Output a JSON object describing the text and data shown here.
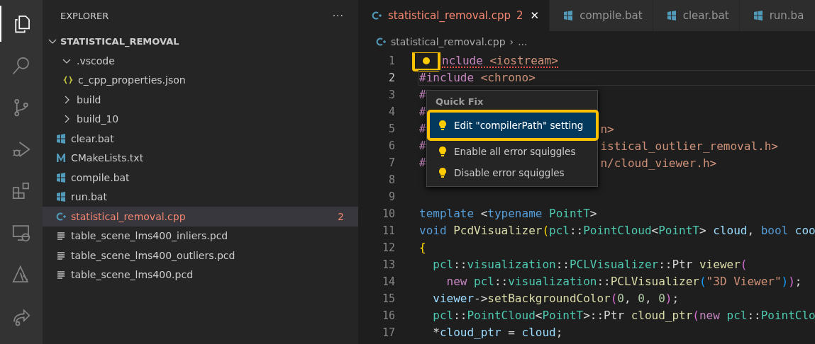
{
  "activity_bar": [
    {
      "selected": true
    },
    {
      "selected": false
    },
    {
      "selected": false
    },
    {
      "selected": false
    },
    {
      "selected": false
    },
    {
      "selected": false
    },
    {
      "selected": false
    },
    {
      "selected": false
    }
  ],
  "sidebar": {
    "title": "EXPLORER",
    "more": "···",
    "root": {
      "label": "STATISTICAL_REMOVAL",
      "expanded": true,
      "children": [
        {
          "label": ".vscode",
          "kind": "folder",
          "expanded": true,
          "selected": false,
          "children": [
            {
              "label": "c_cpp_properties.json",
              "kind": "json",
              "selected": false
            }
          ]
        },
        {
          "label": "build",
          "kind": "folder",
          "expanded": false,
          "selected": false
        },
        {
          "label": "build_10",
          "kind": "folder",
          "expanded": false,
          "selected": false
        },
        {
          "label": "clear.bat",
          "kind": "bat",
          "selected": false
        },
        {
          "label": "CMakeLists.txt",
          "kind": "cmake",
          "selected": false
        },
        {
          "label": "compile.bat",
          "kind": "bat",
          "selected": false
        },
        {
          "label": "run.bat",
          "kind": "bat",
          "selected": false
        },
        {
          "label": "statistical_removal.cpp",
          "kind": "cpp",
          "selected": true,
          "errors": "2"
        },
        {
          "label": "table_scene_lms400_inliers.pcd",
          "kind": "text",
          "selected": false
        },
        {
          "label": "table_scene_lms400_outliers.pcd",
          "kind": "text",
          "selected": false
        },
        {
          "label": "table_scene_lms400.pcd",
          "kind": "text",
          "selected": false
        }
      ]
    }
  },
  "tabs": [
    {
      "label": "statistical_removal.cpp",
      "kind": "cpp",
      "selected": true,
      "errors": "2",
      "close": "✕"
    },
    {
      "label": "compile.bat",
      "kind": "bat",
      "selected": false
    },
    {
      "label": "clear.bat",
      "kind": "bat",
      "selected": false
    },
    {
      "label": "run.ba",
      "kind": "bat",
      "selected": false
    }
  ],
  "breadcrumb": {
    "file": "statistical_removal.cpp",
    "separator": "›",
    "rest": "..."
  },
  "code": [
    {
      "n": "1",
      "current": false,
      "error": true,
      "bulb": true,
      "tokens": [
        {
          "t": "nclude",
          "kind": "pp"
        },
        {
          "t": " <iostream>",
          "kind": "str"
        }
      ]
    },
    {
      "n": "2",
      "current": true,
      "error": false,
      "bulb": false,
      "tokens": [
        {
          "t": "#include",
          "kind": "pp"
        },
        {
          "t": " <chrono>",
          "kind": "str"
        }
      ]
    },
    {
      "n": "3",
      "current": false,
      "error": false,
      "bulb": false,
      "tokens": [
        {
          "t": "#",
          "kind": "pp"
        }
      ]
    },
    {
      "n": "4",
      "current": false,
      "error": false,
      "bulb": false,
      "tokens": [
        {
          "t": "#",
          "kind": "pp"
        }
      ]
    },
    {
      "n": "5",
      "current": false,
      "error": false,
      "bulb": false,
      "tokens": [
        {
          "t": "#",
          "kind": "pp"
        }
      ],
      "tail": {
        "t": "n>",
        "kind": "str"
      }
    },
    {
      "n": "6",
      "current": false,
      "error": false,
      "bulb": false,
      "tokens": [
        {
          "t": "#",
          "kind": "pp"
        }
      ],
      "tail": {
        "t": "istical_outlier_removal.h>",
        "kind": "str"
      }
    },
    {
      "n": "7",
      "current": false,
      "error": false,
      "bulb": false,
      "tokens": [
        {
          "t": "#",
          "kind": "pp"
        }
      ],
      "tail": {
        "t": "n/cloud_viewer.h>",
        "kind": "str"
      }
    },
    {
      "n": "8",
      "current": false,
      "error": false,
      "bulb": false
    },
    {
      "n": "9",
      "current": false,
      "error": false,
      "bulb": false
    },
    {
      "n": "10",
      "current": false,
      "error": false,
      "bulb": false,
      "tokens": [
        {
          "t": "template",
          "kind": "kw"
        },
        {
          "t": " <",
          "kind": "tx"
        },
        {
          "t": "typename",
          "kind": "kw"
        },
        {
          "t": " PointT",
          "kind": "ty"
        },
        {
          "t": ">",
          "kind": "tx"
        }
      ]
    },
    {
      "n": "11",
      "current": false,
      "error": false,
      "bulb": false,
      "tokens": [
        {
          "t": "void",
          "kind": "kw"
        },
        {
          "t": " PcdVisualizer",
          "kind": "fn"
        },
        {
          "t": "(",
          "kind": "b1"
        },
        {
          "t": "pcl",
          "kind": "ty"
        },
        {
          "t": "::",
          "kind": "tx"
        },
        {
          "t": "PointCloud",
          "kind": "ty"
        },
        {
          "t": "<",
          "kind": "tx"
        },
        {
          "t": "PointT",
          "kind": "ty"
        },
        {
          "t": "> ",
          "kind": "tx"
        },
        {
          "t": "cloud",
          "kind": "var"
        },
        {
          "t": ", ",
          "kind": "tx"
        },
        {
          "t": "bool",
          "kind": "kw"
        },
        {
          "t": " coo",
          "kind": "var"
        }
      ]
    },
    {
      "n": "12",
      "current": false,
      "error": false,
      "bulb": false,
      "tokens": [
        {
          "t": "{",
          "kind": "b1"
        }
      ]
    },
    {
      "n": "13",
      "current": false,
      "error": false,
      "bulb": false,
      "tokens": [
        {
          "t": "  pcl",
          "kind": "ty"
        },
        {
          "t": "::",
          "kind": "tx"
        },
        {
          "t": "visualization",
          "kind": "ty"
        },
        {
          "t": "::",
          "kind": "tx"
        },
        {
          "t": "PCLVisualizer",
          "kind": "ty"
        },
        {
          "t": "::",
          "kind": "tx"
        },
        {
          "t": "Ptr",
          "kind": "tx"
        },
        {
          "t": " viewer",
          "kind": "fn"
        },
        {
          "t": "(",
          "kind": "b2"
        }
      ]
    },
    {
      "n": "14",
      "current": false,
      "error": false,
      "bulb": false,
      "tokens": [
        {
          "t": "    new",
          "kind": "pp"
        },
        {
          "t": " pcl",
          "kind": "ty"
        },
        {
          "t": "::",
          "kind": "tx"
        },
        {
          "t": "visualization",
          "kind": "ty"
        },
        {
          "t": "::",
          "kind": "tx"
        },
        {
          "t": "PCLVisualizer",
          "kind": "fn"
        },
        {
          "t": "(",
          "kind": "b3"
        },
        {
          "t": "\"3D Viewer\"",
          "kind": "str"
        },
        {
          "t": ")",
          "kind": "b3"
        },
        {
          "t": ")",
          "kind": "b2"
        },
        {
          "t": ";",
          "kind": "tx"
        }
      ]
    },
    {
      "n": "15",
      "current": false,
      "error": false,
      "bulb": false,
      "tokens": [
        {
          "t": "  viewer",
          "kind": "var"
        },
        {
          "t": "->",
          "kind": "tx"
        },
        {
          "t": "setBackgroundColor",
          "kind": "fn"
        },
        {
          "t": "(",
          "kind": "b2"
        },
        {
          "t": "0",
          "kind": "num"
        },
        {
          "t": ", ",
          "kind": "tx"
        },
        {
          "t": "0",
          "kind": "num"
        },
        {
          "t": ", ",
          "kind": "tx"
        },
        {
          "t": "0",
          "kind": "num"
        },
        {
          "t": ")",
          "kind": "b2"
        },
        {
          "t": ";",
          "kind": "tx"
        }
      ]
    },
    {
      "n": "16",
      "current": false,
      "error": false,
      "bulb": false,
      "tokens": [
        {
          "t": "  pcl",
          "kind": "ty"
        },
        {
          "t": "::",
          "kind": "tx"
        },
        {
          "t": "PointCloud",
          "kind": "ty"
        },
        {
          "t": "<",
          "kind": "tx"
        },
        {
          "t": "PointT",
          "kind": "ty"
        },
        {
          "t": ">::",
          "kind": "tx"
        },
        {
          "t": "Ptr",
          "kind": "tx"
        },
        {
          "t": " cloud_ptr",
          "kind": "fn"
        },
        {
          "t": "(",
          "kind": "b2"
        },
        {
          "t": "new",
          "kind": "pp"
        },
        {
          "t": " pcl",
          "kind": "ty"
        },
        {
          "t": "::",
          "kind": "tx"
        },
        {
          "t": "PointClo",
          "kind": "ty"
        }
      ]
    },
    {
      "n": "17",
      "current": false,
      "error": false,
      "bulb": false,
      "tokens": [
        {
          "t": "  *",
          "kind": "tx"
        },
        {
          "t": "cloud_ptr",
          "kind": "var"
        },
        {
          "t": " = ",
          "kind": "tx"
        },
        {
          "t": "cloud",
          "kind": "var"
        },
        {
          "t": ";",
          "kind": "tx"
        }
      ]
    }
  ],
  "quick_fix": {
    "title": "Quick Fix",
    "items": [
      {
        "label": "Edit \"compilerPath\" setting",
        "selected": true
      },
      {
        "label": "Enable all error squiggles",
        "selected": false
      },
      {
        "label": "Disable error squiggles",
        "selected": false
      }
    ]
  }
}
